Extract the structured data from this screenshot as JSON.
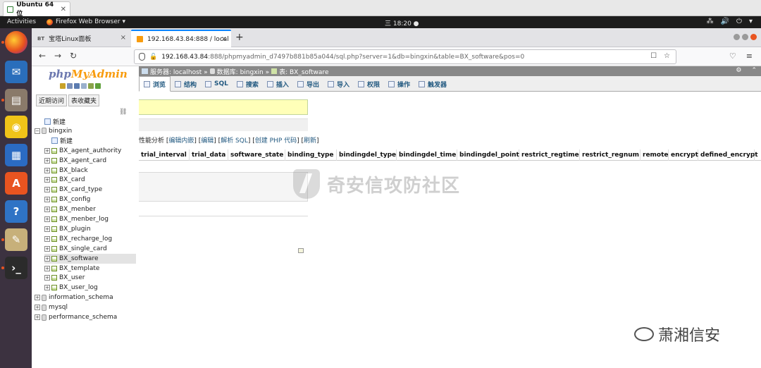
{
  "vm_tab": {
    "label": "Ubuntu 64 位",
    "close": "✕"
  },
  "topbar": {
    "activities": "Activities",
    "app_menu": "Firefox Web Browser ▾",
    "clock": "三 18:20 ●",
    "sys_icons": [
      "⁂",
      "🔊",
      "⏻",
      "▾"
    ]
  },
  "dock": [
    {
      "name": "firefox",
      "color": "#e95420",
      "glyph": ""
    },
    {
      "name": "thunderbird",
      "color": "#2a6ebb",
      "glyph": "✉"
    },
    {
      "name": "files",
      "color": "#8a7a6a",
      "glyph": "▤"
    },
    {
      "name": "rhythmbox",
      "color": "#f0c419",
      "glyph": "◉"
    },
    {
      "name": "writer",
      "color": "#2b6bc2",
      "glyph": "▦"
    },
    {
      "name": "software",
      "color": "#e95420",
      "glyph": "A"
    },
    {
      "name": "help",
      "color": "#2f73c5",
      "glyph": "?"
    },
    {
      "name": "text-editor",
      "color": "#c7b07a",
      "glyph": "✎"
    },
    {
      "name": "terminal",
      "color": "#2b2b2b",
      "glyph": "›_"
    }
  ],
  "browser": {
    "tab1": {
      "icon": "BT",
      "title": "宝塔Linux面板"
    },
    "tab2": {
      "title": "192.168.43.84:888 / local"
    },
    "close": "×",
    "new_tab": "+",
    "back": "←",
    "forward": "→",
    "reload": "↻",
    "url_host": "192.168.43.84",
    "url_path": ":888/phpmyadmin_d7497b881b85a044/sql.php?server=1&db=bingxin&table=BX_software&pos=0",
    "url_icons": [
      "☐",
      "☆"
    ],
    "nav_right": [
      "♡",
      "≡"
    ]
  },
  "pma": {
    "logo_a": "php",
    "logo_b": "MyAdmin",
    "quick": [
      "近期访问",
      "表收藏夹"
    ],
    "tree": [
      {
        "label": "新建",
        "level": 1,
        "type": "new",
        "sel": false
      },
      {
        "label": "bingxin",
        "level": 0,
        "type": "db",
        "sel": false
      },
      {
        "label": "新建",
        "level": 2,
        "type": "new",
        "sel": false
      },
      {
        "label": "BX_agent_authority",
        "level": 2,
        "type": "table",
        "sel": false
      },
      {
        "label": "BX_agent_card",
        "level": 2,
        "type": "table",
        "sel": false
      },
      {
        "label": "BX_black",
        "level": 2,
        "type": "table",
        "sel": false
      },
      {
        "label": "BX_card",
        "level": 2,
        "type": "table",
        "sel": false
      },
      {
        "label": "BX_card_type",
        "level": 2,
        "type": "table",
        "sel": false
      },
      {
        "label": "BX_config",
        "level": 2,
        "type": "table",
        "sel": false
      },
      {
        "label": "BX_menber",
        "level": 2,
        "type": "table",
        "sel": false
      },
      {
        "label": "BX_menber_log",
        "level": 2,
        "type": "table",
        "sel": false
      },
      {
        "label": "BX_plugin",
        "level": 2,
        "type": "table",
        "sel": false
      },
      {
        "label": "BX_recharge_log",
        "level": 2,
        "type": "table",
        "sel": false
      },
      {
        "label": "BX_single_card",
        "level": 2,
        "type": "table",
        "sel": false
      },
      {
        "label": "BX_software",
        "level": 2,
        "type": "table",
        "sel": true
      },
      {
        "label": "BX_template",
        "level": 2,
        "type": "table",
        "sel": false
      },
      {
        "label": "BX_user",
        "level": 2,
        "type": "table",
        "sel": false
      },
      {
        "label": "BX_user_log",
        "level": 2,
        "type": "table",
        "sel": false
      },
      {
        "label": "information_schema",
        "level": 0,
        "type": "db",
        "sel": false
      },
      {
        "label": "mysql",
        "level": 0,
        "type": "db",
        "sel": false
      },
      {
        "label": "performance_schema",
        "level": 0,
        "type": "db",
        "sel": false
      }
    ],
    "breadcrumb": {
      "server": "服务器: localhost »",
      "db": "数据库: bingxin »",
      "table": "表: BX_software",
      "right": [
        "⚙",
        "⌃"
      ]
    },
    "tabs": [
      {
        "label": "浏览",
        "active": true
      },
      {
        "label": "结构",
        "active": false
      },
      {
        "label": "SQL",
        "active": false
      },
      {
        "label": "搜索",
        "active": false
      },
      {
        "label": "插入",
        "active": false
      },
      {
        "label": "导出",
        "active": false
      },
      {
        "label": "导入",
        "active": false
      },
      {
        "label": "权限",
        "active": false
      },
      {
        "label": "操作",
        "active": false
      },
      {
        "label": "触发器",
        "active": false
      }
    ],
    "sql_links": {
      "prefix": "性能分析 [",
      "inline_edit": "编辑内嵌",
      "sep1": "] [",
      "edit": "编辑",
      "sep2": "] [",
      "explain": "解析 SQL",
      "sep3": "] [",
      "create_php": "创建 PHP 代码",
      "sep4": "] [",
      "refresh": "刷新",
      "suffix": "]"
    },
    "columns": [
      {
        "name": "trial_interval"
      },
      {
        "name": "trial_data"
      },
      {
        "name": "software_state"
      },
      {
        "name": "binding_type"
      },
      {
        "name": "bindingdel_type"
      },
      {
        "name": "bindingdel_time"
      },
      {
        "name": "bindingdel_point"
      },
      {
        "name": "restrict_regtime"
      },
      {
        "name": "restrict_regnum"
      },
      {
        "name": "remote"
      },
      {
        "name": "encrypt"
      },
      {
        "name": "defined_encrypt"
      }
    ]
  },
  "watermark": "奇安信攻防社区",
  "brand": "萧湘信安"
}
